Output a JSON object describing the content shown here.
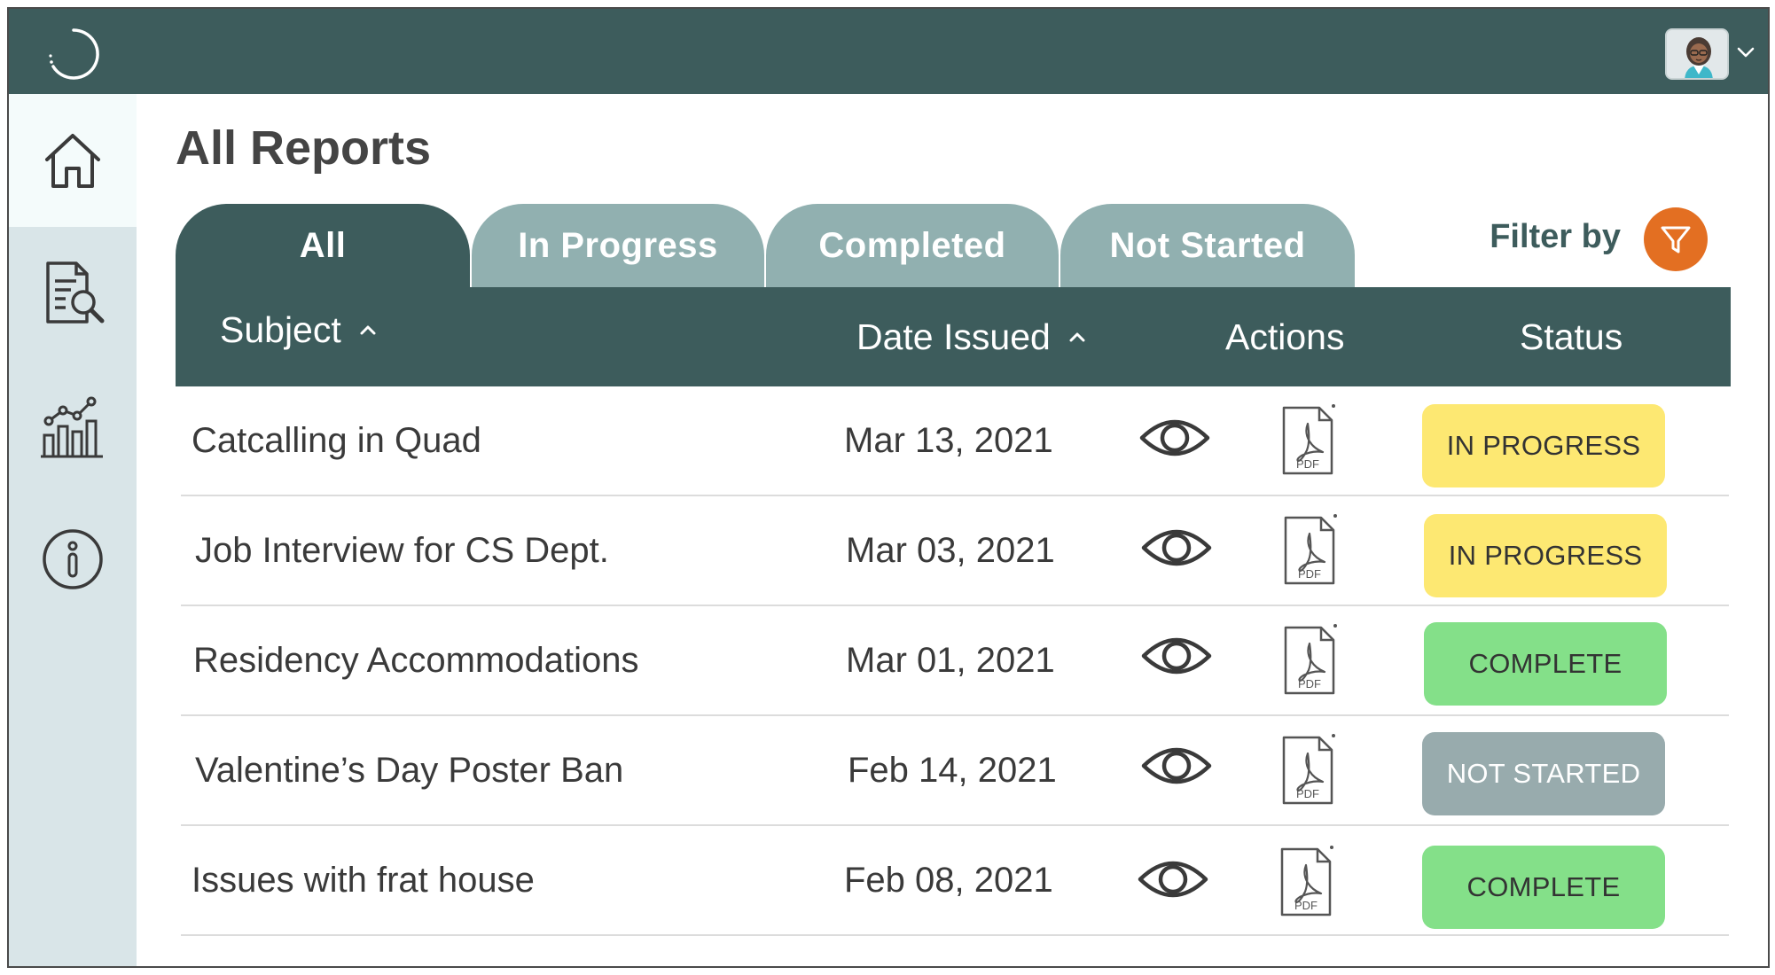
{
  "header": {
    "logo_icon": "circle-logo-icon",
    "avatar_icon": "user-avatar-icon",
    "menu_icon": "chevron-down-icon"
  },
  "sidebar": {
    "items": [
      {
        "icon": "home-icon",
        "active": true
      },
      {
        "icon": "document-search-icon",
        "active": false
      },
      {
        "icon": "bar-chart-icon",
        "active": false
      },
      {
        "icon": "info-icon",
        "active": false
      }
    ]
  },
  "page": {
    "title": "All Reports"
  },
  "tabs": [
    {
      "label": "All",
      "active": true
    },
    {
      "label": "In Progress",
      "active": false
    },
    {
      "label": "Completed",
      "active": false
    },
    {
      "label": "Not Started",
      "active": false
    }
  ],
  "filter": {
    "label": "Filter by",
    "icon": "funnel-icon"
  },
  "table": {
    "columns": {
      "subject": "Subject",
      "date": "Date Issued",
      "actions": "Actions",
      "status": "Status"
    },
    "rows": [
      {
        "subject": "Catcalling in Quad",
        "date": "Mar 13, 2021",
        "status": "IN PROGRESS"
      },
      {
        "subject": "Job Interview for CS Dept.",
        "date": "Mar 03, 2021",
        "status": "IN PROGRESS"
      },
      {
        "subject": "Residency Accommodations",
        "date": "Mar 01, 2021",
        "status": "COMPLETE"
      },
      {
        "subject": "Valentine’s Day Poster Ban",
        "date": "Feb 14, 2021",
        "status": "NOT STARTED"
      },
      {
        "subject": "Issues with frat house",
        "date": "Feb 08, 2021",
        "status": "COMPLETE"
      }
    ],
    "pdf_icon_text": "PDF"
  },
  "colors": {
    "header_bg": "#3d5c5c",
    "tab_inactive": "#91b0b0",
    "sidebar_bg": "#d9e5e8",
    "filter_accent": "#e36f22",
    "status_in_progress": "#fde872",
    "status_complete": "#84e089",
    "status_not_started": "#98abad"
  }
}
